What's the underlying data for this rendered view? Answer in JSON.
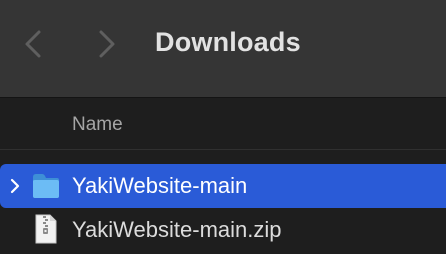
{
  "toolbar": {
    "title": "Downloads",
    "back_icon": "chevron-left-icon",
    "forward_icon": "chevron-right-icon"
  },
  "columns": {
    "name_label": "Name"
  },
  "files": [
    {
      "name": "YakiWebsite-main",
      "kind": "folder",
      "icon": "folder-icon",
      "selected": true,
      "expandable": true
    },
    {
      "name": "YakiWebsite-main.zip",
      "kind": "zip",
      "icon": "zip-file-icon",
      "selected": false,
      "expandable": false
    }
  ],
  "colors": {
    "toolbar_bg": "#353535",
    "list_bg": "#1e1e1e",
    "selection": "#2a5bd7",
    "folder": "#5fb4f2"
  }
}
